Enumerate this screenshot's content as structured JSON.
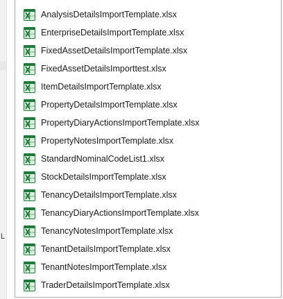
{
  "left_strip": {
    "glyph": "L"
  },
  "file_list": {
    "icon": "excel-icon",
    "colors": {
      "icon_green": "#1f7a3a",
      "icon_light": "#d9f0dd"
    },
    "items": [
      {
        "name": "AnalysisDetailsImportTemplate.xlsx"
      },
      {
        "name": "EnterpriseDetailsImportTemplate.xlsx"
      },
      {
        "name": "FixedAssetDetailsImportTemplate.xlsx"
      },
      {
        "name": "FixedAssetDetailsImporttest.xlsx"
      },
      {
        "name": "ItemDetailsImportTemplate.xlsx"
      },
      {
        "name": "PropertyDetailsImportTemplate.xlsx"
      },
      {
        "name": "PropertyDiaryActionsImportTemplate.xlsx"
      },
      {
        "name": "PropertyNotesImportTemplate.xlsx"
      },
      {
        "name": "StandardNominalCodeList1.xlsx"
      },
      {
        "name": "StockDetailsImportTemplate.xlsx"
      },
      {
        "name": "TenancyDetailsImportTemplate.xlsx"
      },
      {
        "name": "TenancyDiaryActionsImportTemplate.xlsx"
      },
      {
        "name": "TenancyNotesImportTemplate.xlsx"
      },
      {
        "name": "TenantDetailsImportTemplate.xlsx"
      },
      {
        "name": "TenantNotesImportTemplate.xlsx"
      },
      {
        "name": "TraderDetailsImportTemplate.xlsx"
      }
    ]
  }
}
